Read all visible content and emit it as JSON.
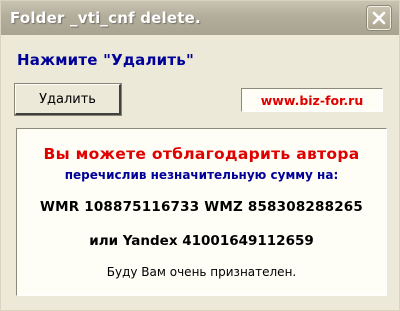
{
  "window": {
    "title": "Folder _vti_cnf delete."
  },
  "icons": {
    "close": "close-icon"
  },
  "dialog": {
    "prompt": "Нажмите \"Удалить\"",
    "delete_button": "Удалить",
    "site": "www.biz-for.ru"
  },
  "donation": {
    "heading": "Вы можете отблагодарить автора",
    "subheading": "перечислив незначительную сумму на:",
    "wallets_line": "WMR 108875116733  WMZ 858308288265",
    "yandex_line": "или Yandex 41001649112659",
    "thanks": "Буду Вам очень признателен."
  },
  "colors": {
    "accent_blue": "#000099",
    "accent_red": "#e00000",
    "dialog_bg": "#ece9d8"
  }
}
